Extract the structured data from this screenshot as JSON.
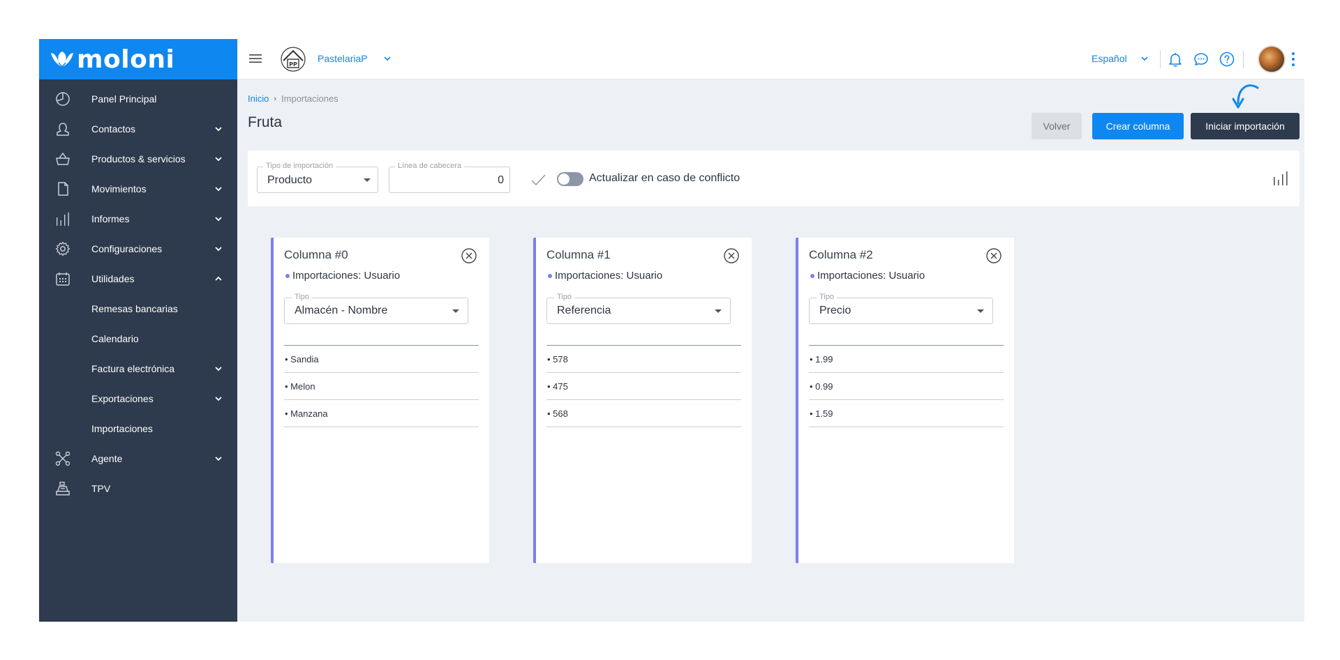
{
  "sidebar": {
    "brand": "moloni",
    "items": [
      {
        "label": "Panel Principal",
        "icon": "pie-chart-icon",
        "chevron": "none"
      },
      {
        "label": "Contactos",
        "icon": "person-icon",
        "chevron": "down"
      },
      {
        "label": "Productos & servicios",
        "icon": "basket-icon",
        "chevron": "down"
      },
      {
        "label": "Movimientos",
        "icon": "document-icon",
        "chevron": "down"
      },
      {
        "label": "Informes",
        "icon": "bar-chart-icon",
        "chevron": "down"
      },
      {
        "label": "Configuraciones",
        "icon": "gear-icon",
        "chevron": "down"
      },
      {
        "label": "Utilidades",
        "icon": "calendar-grid-icon",
        "chevron": "up"
      },
      {
        "label": "Remesas bancarias",
        "icon": "",
        "chevron": "none"
      },
      {
        "label": "Calendario",
        "icon": "",
        "chevron": "none"
      },
      {
        "label": "Factura electrónica",
        "icon": "",
        "chevron": "down"
      },
      {
        "label": "Exportaciones",
        "icon": "",
        "chevron": "down"
      },
      {
        "label": "Importaciones",
        "icon": "",
        "chevron": "none"
      },
      {
        "label": "Agente",
        "icon": "network-icon",
        "chevron": "down"
      },
      {
        "label": "TPV",
        "icon": "cash-register-icon",
        "chevron": "none"
      }
    ]
  },
  "topbar": {
    "company": "PastelariaP",
    "company_logo_text": "PP",
    "language": "Español"
  },
  "breadcrumb": {
    "home": "Inicio",
    "current": "Importaciones"
  },
  "page": {
    "title": "Fruta",
    "back_label": "Volver",
    "create_label": "Crear columna",
    "start_label": "Iniciar importación"
  },
  "filters": {
    "import_type_label": "Tipo de importación",
    "import_type_value": "Producto",
    "header_line_label": "Línea de cabecera",
    "header_line_value": "0",
    "conflict_label": "Actualizar en caso de conflicto"
  },
  "columns": [
    {
      "title": "Columna #0",
      "origin": "Importaciones: Usuario",
      "type_label": "Tipo",
      "type_value": "Almacén - Nombre",
      "values": [
        "• Sandia",
        "• Melon",
        "• Manzana"
      ]
    },
    {
      "title": "Columna #1",
      "origin": "Importaciones: Usuario",
      "type_label": "Tipo",
      "type_value": "Referencia",
      "values": [
        "• 578",
        "• 475",
        "• 568"
      ]
    },
    {
      "title": "Columna #2",
      "origin": "Importaciones: Usuario",
      "type_label": "Tipo",
      "type_value": "Precio",
      "values": [
        "• 1.99",
        "• 0.99",
        "• 1.59"
      ]
    }
  ],
  "colors": {
    "brand_blue": "#0e87f0",
    "sidebar_bg": "#2e3a4d",
    "column_accent": "#7b7ff0",
    "toggle_off": "#8d96a8"
  }
}
